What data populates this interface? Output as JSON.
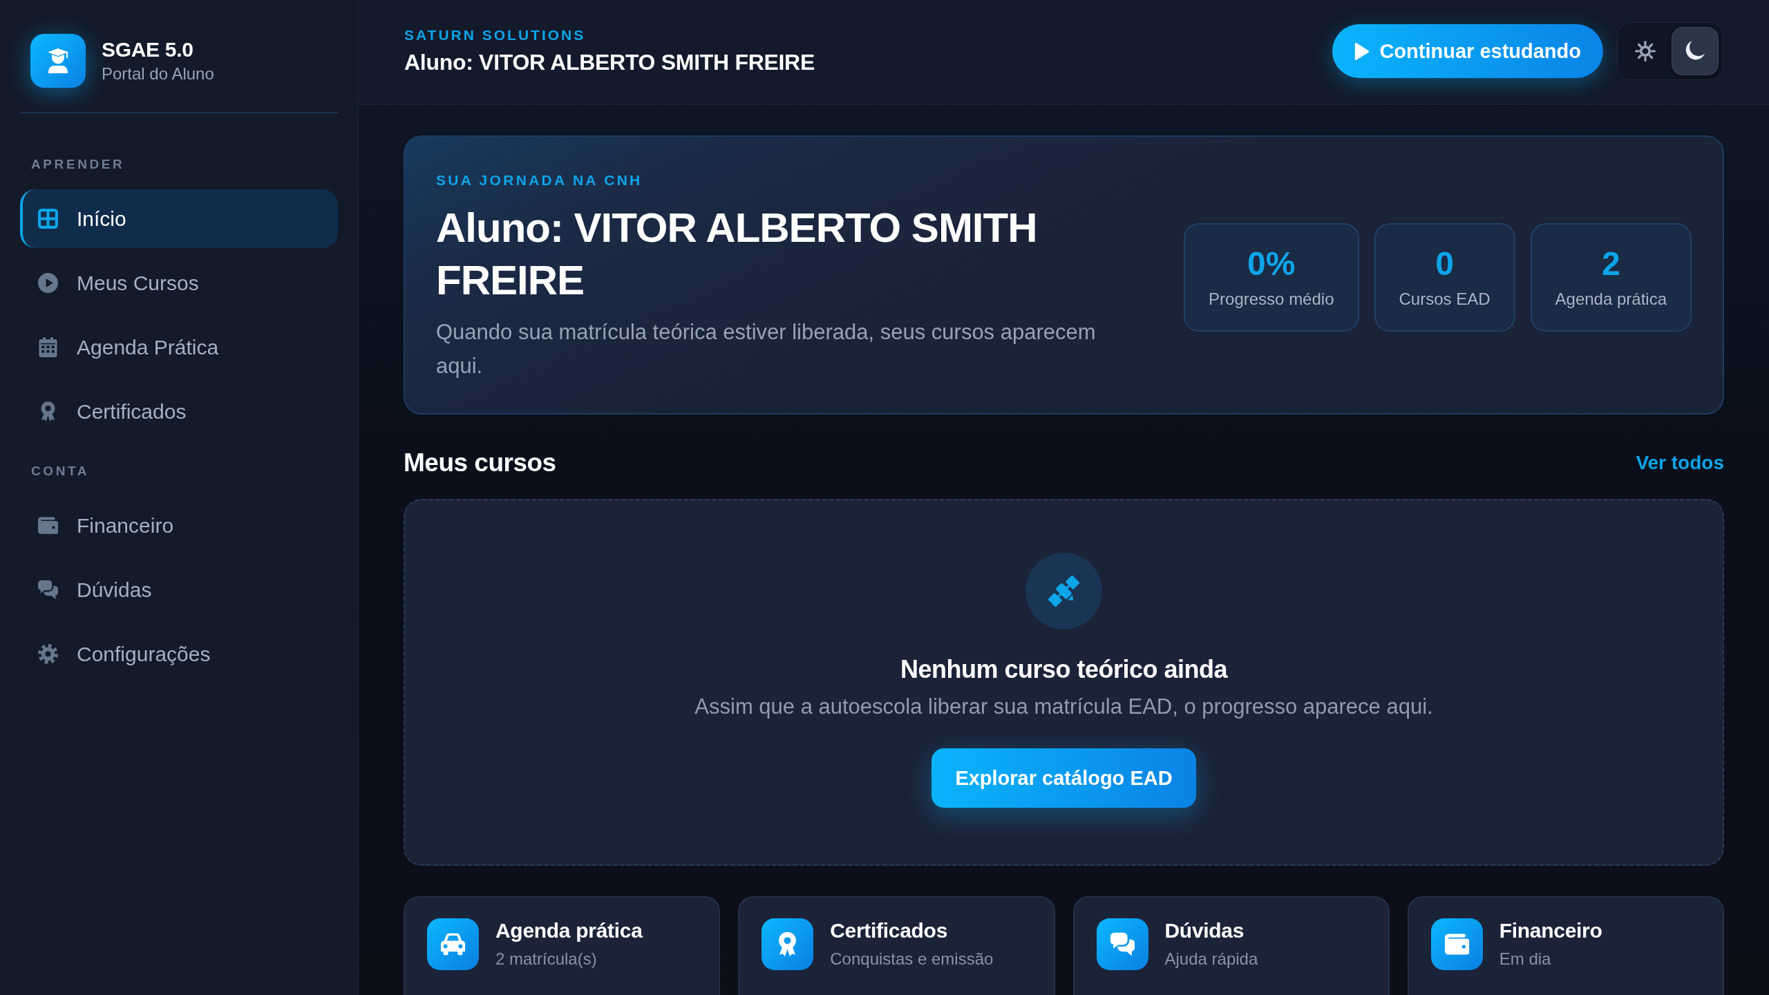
{
  "sidebar": {
    "brand": {
      "title": "SGAE 5.0",
      "subtitle": "Portal do Aluno"
    },
    "sections": [
      {
        "heading": "APRENDER",
        "items": [
          {
            "label": "Início",
            "selected": true
          },
          {
            "label": "Meus Cursos",
            "selected": false
          },
          {
            "label": "Agenda Prática",
            "selected": false
          },
          {
            "label": "Certificados",
            "selected": false
          }
        ]
      },
      {
        "heading": "CONTA",
        "items": [
          {
            "label": "Financeiro",
            "selected": false
          },
          {
            "label": "Dúvidas",
            "selected": false
          },
          {
            "label": "Configurações",
            "selected": false
          }
        ]
      }
    ]
  },
  "header": {
    "eyebrow": "SATURN SOLUTIONS",
    "title": "Aluno: VITOR ALBERTO SMITH FREIRE",
    "primary_button": "Continuar estudando",
    "theme_modes": [
      {
        "kind": "light",
        "selected": false
      },
      {
        "kind": "dark",
        "selected": true
      }
    ]
  },
  "hero": {
    "eyebrow": "SUA JORNADA NA CNH",
    "title": "Aluno: VITOR ALBERTO SMITH FREIRE",
    "description": "Quando sua matrícula teórica estiver liberada, seus cursos aparecem aqui.",
    "stats": [
      {
        "value": "0%",
        "label": "Progresso médio"
      },
      {
        "value": "0",
        "label": "Cursos EAD"
      },
      {
        "value": "2",
        "label": "Agenda prática"
      }
    ]
  },
  "courses": {
    "title": "Meus cursos",
    "link": "Ver todos",
    "empty_state": {
      "title": "Nenhum curso teórico ainda",
      "description": "Assim que a autoescola liberar sua matrícula EAD, o progresso aparece aqui.",
      "button": "Explorar catálogo EAD"
    }
  },
  "shortcuts": [
    {
      "title": "Agenda prática",
      "subtitle": "2 matrícula(s)"
    },
    {
      "title": "Certificados",
      "subtitle": "Conquistas e emissão"
    },
    {
      "title": "Dúvidas",
      "subtitle": "Ajuda rápida"
    },
    {
      "title": "Financeiro",
      "subtitle": "Em dia"
    }
  ]
}
